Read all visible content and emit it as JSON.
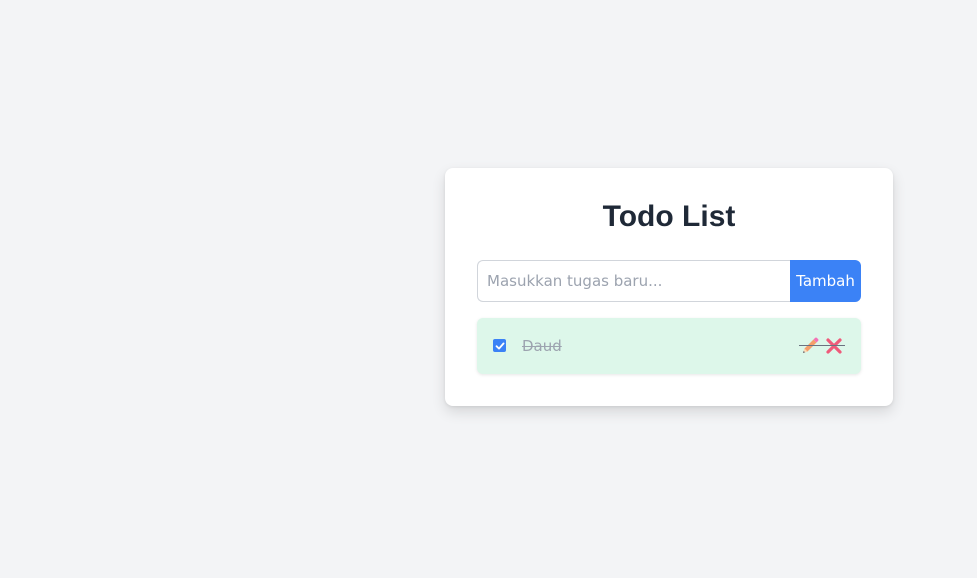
{
  "app": {
    "title": "Todo List"
  },
  "input": {
    "placeholder": "Masukkan tugas baru...",
    "value": ""
  },
  "add_button": {
    "label": "Tambah"
  },
  "todos": [
    {
      "text": "Daud",
      "completed": true,
      "edit_icon": "pencil-icon",
      "delete_icon": "close-icon"
    }
  ],
  "colors": {
    "accent": "#3b82f6",
    "completed_bg": "#ddf7ea",
    "delete": "#ef5a7a",
    "background": "#f3f4f6"
  }
}
